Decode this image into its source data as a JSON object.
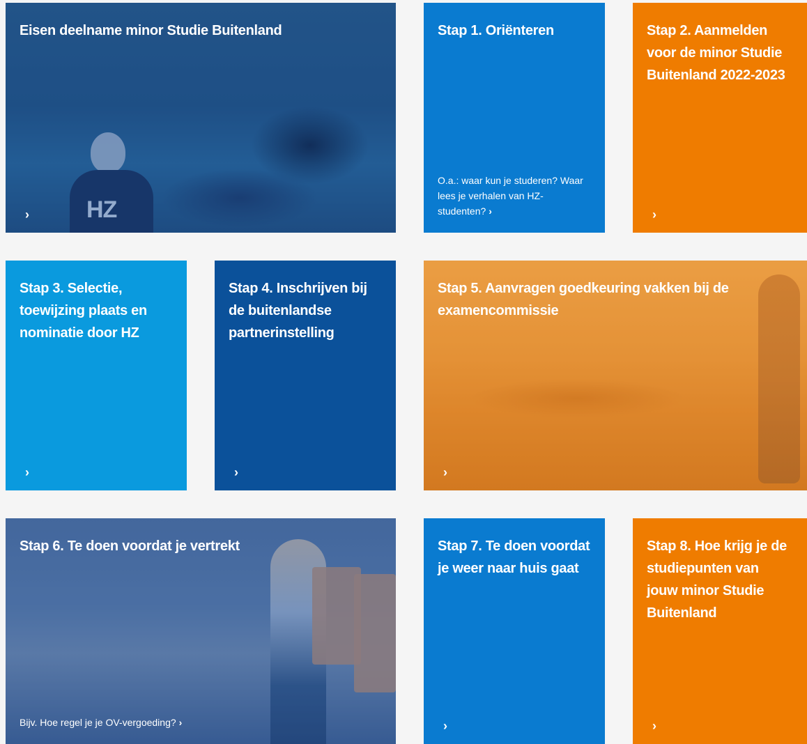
{
  "tiles": [
    {
      "id": "eisen",
      "title": "Eisen deelname minor Studie Buitenland",
      "chevron": "›"
    },
    {
      "id": "stap1",
      "title": "Stap 1. Oriënteren",
      "subtitle": "O.a.: waar kun je studeren? Waar lees je verhalen van HZ-studenten?",
      "chevron": "›"
    },
    {
      "id": "stap2",
      "title": "Stap 2. Aanmelden voor de minor Studie Buitenland 2022-2023",
      "chevron": "›"
    },
    {
      "id": "stap3",
      "title": "Stap 3. Selectie, toewijzing plaats en nominatie door HZ",
      "chevron": "›"
    },
    {
      "id": "stap4",
      "title": "Stap 4. Inschrijven bij de buitenlandse partnerinstelling",
      "chevron": "›"
    },
    {
      "id": "stap5",
      "title": "Stap 5. Aanvragen goedkeuring vakken bij de examencommissie",
      "chevron": "›"
    },
    {
      "id": "stap6",
      "title": "Stap 6. Te doen voordat je vertrekt",
      "subtitle": "Bijv. Hoe regel je je OV-vergoeding?",
      "chevron": "›"
    },
    {
      "id": "stap7",
      "title": "Stap 7. Te doen voordat je weer naar huis gaat",
      "chevron": "›"
    },
    {
      "id": "stap8",
      "title": "Stap 8. Hoe krijg je de studiepunten van jouw minor Studie Buitenland",
      "chevron": "›"
    }
  ],
  "photo_text": {
    "hz_logo": "HZ"
  },
  "colors": {
    "blue": "#0a7bd0",
    "light_blue": "#0a9ade",
    "dark_blue": "#0b519a",
    "orange": "#ef7c00",
    "background": "#f5f5f5"
  },
  "icons": {
    "chevron": "chevron-right-icon"
  }
}
